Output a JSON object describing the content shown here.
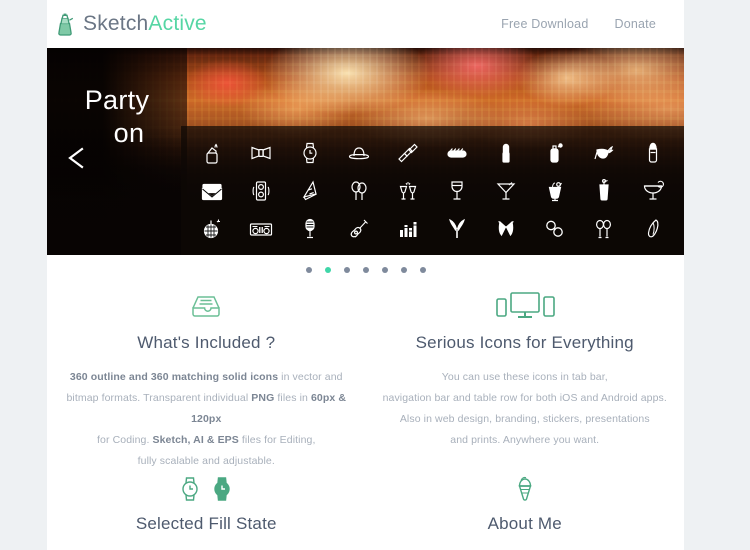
{
  "brand": {
    "icon": "moka-pot-icon",
    "name_part1": "Sketch",
    "name_part2": "Active",
    "color_part1": "#6b7685",
    "color_part2": "#56d6a4"
  },
  "nav": {
    "items": [
      {
        "label": "Free Download"
      },
      {
        "label": "Donate"
      }
    ]
  },
  "hero": {
    "title_line1": "Party",
    "title_line2": "on",
    "prev_arrow": "chevron-left-icon",
    "icons": [
      "lighter-icon",
      "bow-tie-icon",
      "wristwatch-icon",
      "bowler-hat-icon",
      "scarf-icon",
      "hot-dog-icon",
      "lipstick-icon",
      "perfume-bottle-icon",
      "masquerade-mask-icon",
      "salt-shaker-icon",
      "mail-envelope-icon",
      "speaker-icon",
      "party-hat-icon",
      "balloons-icon",
      "cheers-glasses-icon",
      "wine-glass-icon",
      "martini-glass-icon",
      "pina-colada-icon",
      "highball-drink-icon",
      "margarita-icon",
      "disco-ball-icon",
      "dj-mixer-icon",
      "microphone-icon",
      "electric-guitar-icon",
      "equalizer-icon",
      "bunny-ears-icon",
      "bikini-top-icon",
      "handcuffs-icon",
      "maracas-icon",
      "feather-icon"
    ]
  },
  "carousel": {
    "dots": [
      {
        "active": false
      },
      {
        "active": true
      },
      {
        "active": false
      },
      {
        "active": false
      },
      {
        "active": false
      },
      {
        "active": false
      },
      {
        "active": false
      }
    ],
    "active_color": "#3fd6a8",
    "inactive_color": "#7f8a9c"
  },
  "features": [
    {
      "icon": "file-tray-icon",
      "title": "What's Included ?",
      "lines": [
        [
          {
            "text": "360 outline and 360 matching solid icons",
            "bold": true
          },
          {
            "text": " in vector and",
            "bold": false
          }
        ],
        [
          {
            "text": "bitmap formats. Transparent individual ",
            "bold": false
          },
          {
            "text": "PNG",
            "bold": true
          },
          {
            "text": " files in ",
            "bold": false
          },
          {
            "text": "60px & 120px",
            "bold": true
          }
        ],
        [
          {
            "text": "for Coding. ",
            "bold": false
          },
          {
            "text": "Sketch, AI & EPS",
            "bold": true
          },
          {
            "text": " files for Editing,",
            "bold": false
          }
        ],
        [
          {
            "text": "fully scalable and adjustable.",
            "bold": false
          }
        ]
      ]
    },
    {
      "icon": "devices-icon",
      "title": "Serious Icons for Everything",
      "lines": [
        [
          {
            "text": "You can use these icons in tab bar,",
            "bold": false
          }
        ],
        [
          {
            "text": "navigation bar and table row for both iOS and Android apps.",
            "bold": false
          }
        ],
        [
          {
            "text": "Also in web design, branding, stickers, presentations",
            "bold": false
          }
        ],
        [
          {
            "text": "and prints. Anywhere you want.",
            "bold": false
          }
        ]
      ]
    }
  ],
  "features_row2": [
    {
      "icon": "watch-pair-icon",
      "title": "Selected Fill State"
    },
    {
      "icon": "ice-cream-cone-icon",
      "title": "About Me"
    }
  ],
  "theme": {
    "page_background": "#eef1f3",
    "sheet_background": "#ffffff",
    "accent_green": "#4ba882",
    "heading_color": "#4e5a6e",
    "body_color": "#a8b0bb",
    "nav_color": "#9aa4b0"
  }
}
